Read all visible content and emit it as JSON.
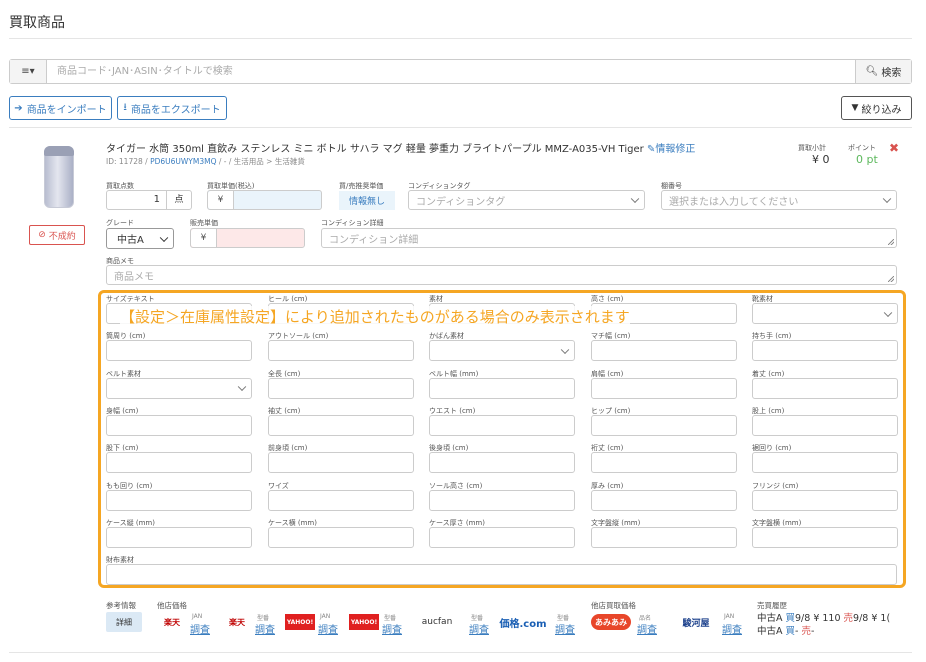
{
  "page": {
    "title": "買取商品"
  },
  "search": {
    "placeholder": "商品コード･JAN･ASIN･タイトルで検索",
    "filter_icon": "≡▾",
    "button": "検索"
  },
  "actions": {
    "import": "商品をインポート",
    "export": "商品をエクスポート",
    "filter": "絞り込み"
  },
  "product": {
    "title": "タイガー 水筒 350ml 直飲み ステンレス ミニ ボトル サハラ マグ 軽量 夢重力 ブライトパープル MMZ-A035-VH Tiger",
    "edit_link": "情報修正",
    "id_text": "ID: 11728 /",
    "asin": "PD6U6UWYM3MQ",
    "category": "/ - / 生活用品 > 生活雑貨",
    "status": "不成約",
    "subtotal_label": "買取小計",
    "subtotal_value": "¥ 0",
    "point_label": "ポイント",
    "point_value": "0 pt"
  },
  "form": {
    "qty_label": "買取点数",
    "qty_value": "1",
    "qty_unit": "点",
    "unit_price_label": "買取単価(税込)",
    "yen": "¥",
    "recommend_label": "買/売推奨単価",
    "recommend_value": "情報無し",
    "condition_tag_label": "コンディションタグ",
    "condition_tag_placeholder": "コンディションタグ",
    "shelf_label": "棚番号",
    "shelf_placeholder": "選択または入力してください",
    "grade_label": "グレード",
    "grade_value": "中古A",
    "sell_price_label": "販売単価",
    "condition_detail_label": "コンディション詳細",
    "condition_detail_placeholder": "コンディション詳細",
    "memo_label": "商品メモ",
    "memo_placeholder": "商品メモ"
  },
  "banner": "【設定＞在庫属性設定】により追加されたものがある場合のみ表示されます",
  "attributes": [
    [
      "サイズテキスト",
      "ヒール (cm)",
      "素材",
      "高さ (cm)",
      "靴素材"
    ],
    [
      "筒周り (cm)",
      "アウトソール (cm)",
      "かばん素材",
      "マチ幅 (cm)",
      "持ち手 (cm)"
    ],
    [
      "ベルト素材",
      "全長 (cm)",
      "ベルト幅 (mm)",
      "肩幅 (cm)",
      "着丈 (cm)"
    ],
    [
      "身幅 (cm)",
      "袖丈 (cm)",
      "ウエスト (cm)",
      "ヒップ (cm)",
      "股上 (cm)"
    ],
    [
      "股下 (cm)",
      "前身頃 (cm)",
      "後身頃 (cm)",
      "裄丈 (cm)",
      "裾回り (cm)"
    ],
    [
      "もも回り (cm)",
      "ワイズ",
      "ソール高さ (cm)",
      "厚み (cm)",
      "フリンジ (cm)"
    ],
    [
      "ケース縦 (mm)",
      "ケース横 (mm)",
      "ケース厚さ (mm)",
      "文字盤縦 (mm)",
      "文字盤横 (mm)"
    ]
  ],
  "wallet_label": "財布素材",
  "bottom": {
    "ref_label": "参考情報",
    "detail": "詳細",
    "other_price_label": "他店価格",
    "other_buy_label": "他店買取価格",
    "history_label": "売買履歴",
    "shops": [
      {
        "logo": "楽天",
        "tag": "JAN",
        "link": "調査"
      },
      {
        "logo": "楽天",
        "tag": "型番",
        "link": "調査"
      },
      {
        "logo": "YAHOO!",
        "tag": "JAN",
        "link": "調査"
      },
      {
        "logo": "YAHOO!",
        "tag": "型番",
        "link": "調査"
      },
      {
        "logo": "aucfan",
        "tag": "型番",
        "link": "調査"
      },
      {
        "logo": "価格.com",
        "tag": "型番",
        "link": "調査"
      },
      {
        "logo": "あみあみ",
        "tag": "品名",
        "link": "調査"
      },
      {
        "logo": "駿河屋",
        "tag": "JAN",
        "link": "調査"
      }
    ],
    "history": [
      {
        "grade": "中古A",
        "buy": "買",
        "buy_val": "9/8 ¥ 110",
        "sell": "売",
        "sell_val": "9/8 ¥ 1("
      },
      {
        "grade": "中古A",
        "buy": "買",
        "buy_val": "-",
        "sell": "売",
        "sell_val": "-"
      }
    ]
  },
  "colors": {
    "accent": "#3a7dbf",
    "highlight": "#f5a623",
    "danger": "#d9534f",
    "point": "#5cb85c"
  }
}
